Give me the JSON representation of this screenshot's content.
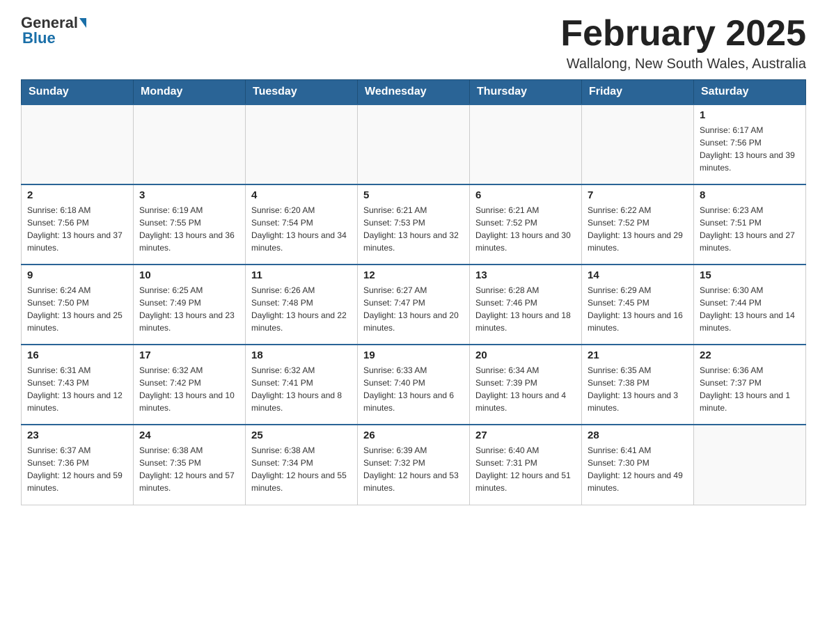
{
  "header": {
    "logo_general": "General",
    "logo_blue": "Blue",
    "title": "February 2025",
    "subtitle": "Wallalong, New South Wales, Australia"
  },
  "days_of_week": [
    "Sunday",
    "Monday",
    "Tuesday",
    "Wednesday",
    "Thursday",
    "Friday",
    "Saturday"
  ],
  "weeks": [
    [
      {
        "day": "",
        "info": ""
      },
      {
        "day": "",
        "info": ""
      },
      {
        "day": "",
        "info": ""
      },
      {
        "day": "",
        "info": ""
      },
      {
        "day": "",
        "info": ""
      },
      {
        "day": "",
        "info": ""
      },
      {
        "day": "1",
        "info": "Sunrise: 6:17 AM\nSunset: 7:56 PM\nDaylight: 13 hours and 39 minutes."
      }
    ],
    [
      {
        "day": "2",
        "info": "Sunrise: 6:18 AM\nSunset: 7:56 PM\nDaylight: 13 hours and 37 minutes."
      },
      {
        "day": "3",
        "info": "Sunrise: 6:19 AM\nSunset: 7:55 PM\nDaylight: 13 hours and 36 minutes."
      },
      {
        "day": "4",
        "info": "Sunrise: 6:20 AM\nSunset: 7:54 PM\nDaylight: 13 hours and 34 minutes."
      },
      {
        "day": "5",
        "info": "Sunrise: 6:21 AM\nSunset: 7:53 PM\nDaylight: 13 hours and 32 minutes."
      },
      {
        "day": "6",
        "info": "Sunrise: 6:21 AM\nSunset: 7:52 PM\nDaylight: 13 hours and 30 minutes."
      },
      {
        "day": "7",
        "info": "Sunrise: 6:22 AM\nSunset: 7:52 PM\nDaylight: 13 hours and 29 minutes."
      },
      {
        "day": "8",
        "info": "Sunrise: 6:23 AM\nSunset: 7:51 PM\nDaylight: 13 hours and 27 minutes."
      }
    ],
    [
      {
        "day": "9",
        "info": "Sunrise: 6:24 AM\nSunset: 7:50 PM\nDaylight: 13 hours and 25 minutes."
      },
      {
        "day": "10",
        "info": "Sunrise: 6:25 AM\nSunset: 7:49 PM\nDaylight: 13 hours and 23 minutes."
      },
      {
        "day": "11",
        "info": "Sunrise: 6:26 AM\nSunset: 7:48 PM\nDaylight: 13 hours and 22 minutes."
      },
      {
        "day": "12",
        "info": "Sunrise: 6:27 AM\nSunset: 7:47 PM\nDaylight: 13 hours and 20 minutes."
      },
      {
        "day": "13",
        "info": "Sunrise: 6:28 AM\nSunset: 7:46 PM\nDaylight: 13 hours and 18 minutes."
      },
      {
        "day": "14",
        "info": "Sunrise: 6:29 AM\nSunset: 7:45 PM\nDaylight: 13 hours and 16 minutes."
      },
      {
        "day": "15",
        "info": "Sunrise: 6:30 AM\nSunset: 7:44 PM\nDaylight: 13 hours and 14 minutes."
      }
    ],
    [
      {
        "day": "16",
        "info": "Sunrise: 6:31 AM\nSunset: 7:43 PM\nDaylight: 13 hours and 12 minutes."
      },
      {
        "day": "17",
        "info": "Sunrise: 6:32 AM\nSunset: 7:42 PM\nDaylight: 13 hours and 10 minutes."
      },
      {
        "day": "18",
        "info": "Sunrise: 6:32 AM\nSunset: 7:41 PM\nDaylight: 13 hours and 8 minutes."
      },
      {
        "day": "19",
        "info": "Sunrise: 6:33 AM\nSunset: 7:40 PM\nDaylight: 13 hours and 6 minutes."
      },
      {
        "day": "20",
        "info": "Sunrise: 6:34 AM\nSunset: 7:39 PM\nDaylight: 13 hours and 4 minutes."
      },
      {
        "day": "21",
        "info": "Sunrise: 6:35 AM\nSunset: 7:38 PM\nDaylight: 13 hours and 3 minutes."
      },
      {
        "day": "22",
        "info": "Sunrise: 6:36 AM\nSunset: 7:37 PM\nDaylight: 13 hours and 1 minute."
      }
    ],
    [
      {
        "day": "23",
        "info": "Sunrise: 6:37 AM\nSunset: 7:36 PM\nDaylight: 12 hours and 59 minutes."
      },
      {
        "day": "24",
        "info": "Sunrise: 6:38 AM\nSunset: 7:35 PM\nDaylight: 12 hours and 57 minutes."
      },
      {
        "day": "25",
        "info": "Sunrise: 6:38 AM\nSunset: 7:34 PM\nDaylight: 12 hours and 55 minutes."
      },
      {
        "day": "26",
        "info": "Sunrise: 6:39 AM\nSunset: 7:32 PM\nDaylight: 12 hours and 53 minutes."
      },
      {
        "day": "27",
        "info": "Sunrise: 6:40 AM\nSunset: 7:31 PM\nDaylight: 12 hours and 51 minutes."
      },
      {
        "day": "28",
        "info": "Sunrise: 6:41 AM\nSunset: 7:30 PM\nDaylight: 12 hours and 49 minutes."
      },
      {
        "day": "",
        "info": ""
      }
    ]
  ]
}
